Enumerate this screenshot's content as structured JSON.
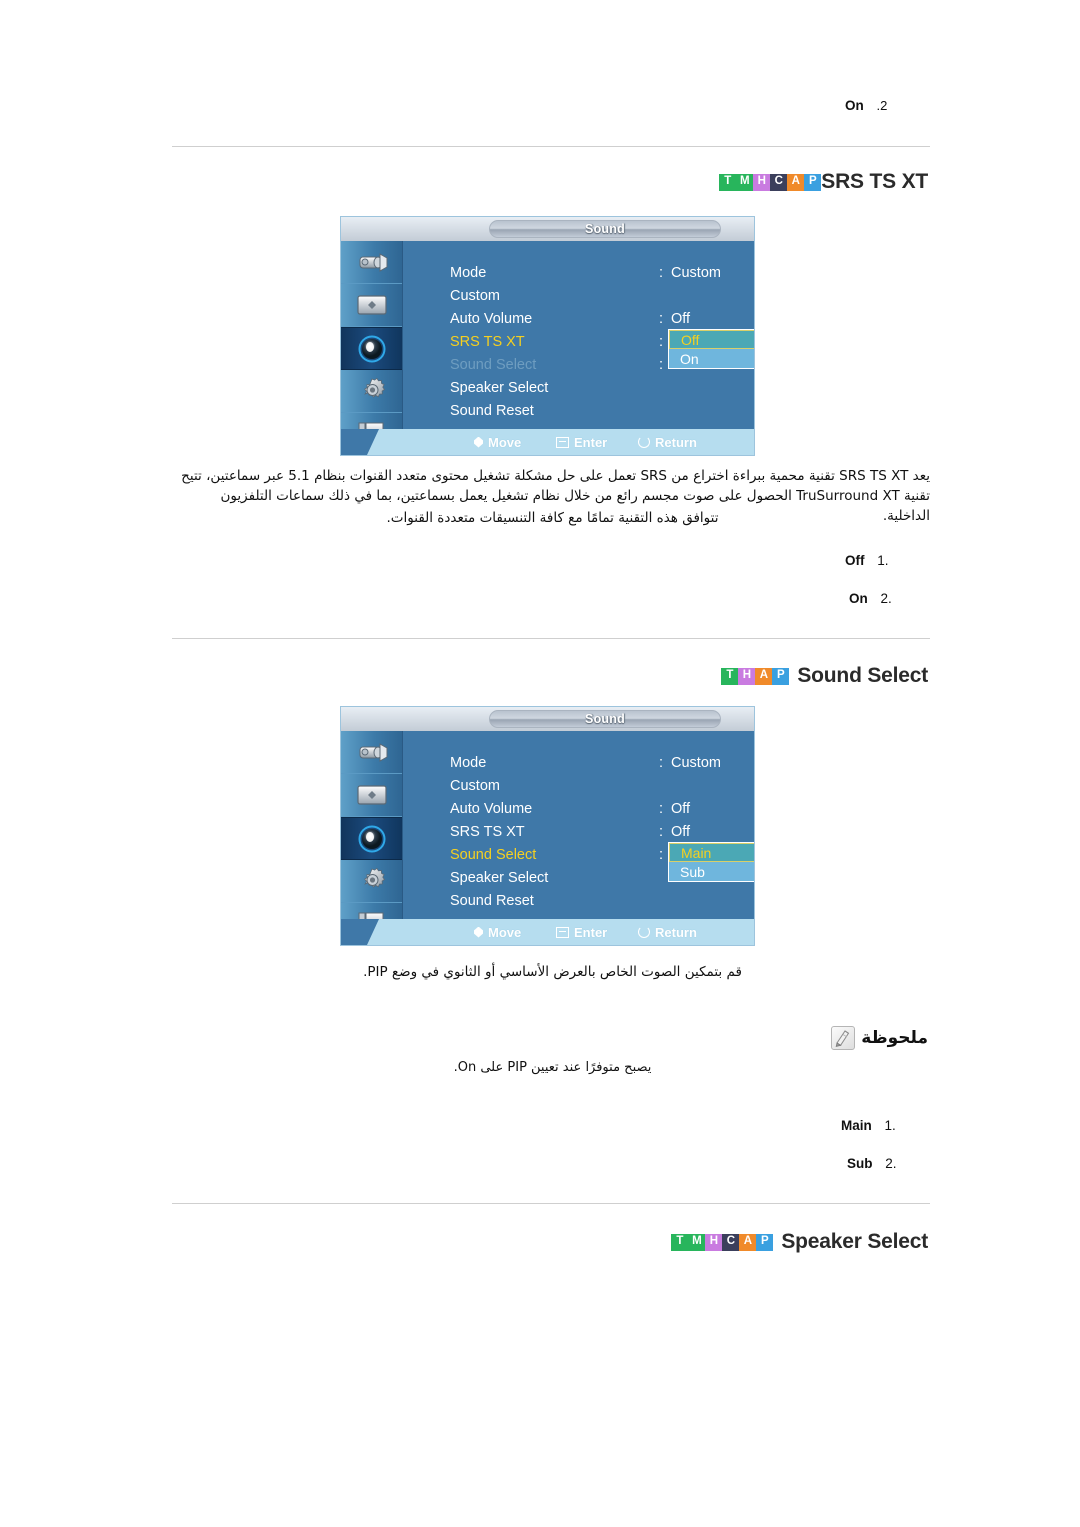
{
  "top_step": {
    "label": "On",
    "number": ".2"
  },
  "sections": [
    {
      "id": "srs-ts-xt",
      "badges": [
        {
          "letter": "T",
          "color": "#28b55c"
        },
        {
          "letter": "M",
          "color": "#28b55c"
        },
        {
          "letter": "H",
          "color": "#c97be0"
        },
        {
          "letter": "C",
          "color": "#3b3f5c"
        },
        {
          "letter": "A",
          "color": "#f08a2a"
        },
        {
          "letter": "P",
          "color": "#3aa0e0"
        }
      ],
      "title": "SRS TS XT",
      "osd": {
        "title": "Sound",
        "rows": [
          {
            "label": "Mode",
            "colon": ":",
            "value": "Custom",
            "state": "normal"
          },
          {
            "label": "Custom",
            "colon": "",
            "value": "",
            "state": "normal"
          },
          {
            "label": "Auto Volume",
            "colon": ":",
            "value": "Off",
            "state": "normal"
          },
          {
            "label": "SRS TS XT",
            "colon": ":",
            "value": "",
            "state": "active"
          },
          {
            "label": "Sound Select",
            "colon": ":",
            "value": "",
            "state": "dim"
          },
          {
            "label": "Speaker Select",
            "colon": "",
            "value": "",
            "state": "normal"
          },
          {
            "label": "Sound Reset",
            "colon": "",
            "value": "",
            "state": "normal"
          }
        ],
        "dropdown": {
          "selected": "Off",
          "other": "On"
        },
        "footer": [
          {
            "icon": "move-diamond-icon",
            "label": "Move"
          },
          {
            "icon": "enter-icon",
            "label": "Enter"
          },
          {
            "icon": "return-icon",
            "label": "Return"
          }
        ],
        "sidebar_icons": [
          "input-source-icon",
          "picture-icon",
          "sound-icon",
          "setup-icon",
          "multi-control-icon"
        ]
      },
      "paragraphs": [
        "يعد SRS TS XT تقنية محمية ببراءة اختراع من SRS تعمل على حل مشكلة تشغيل محتوى متعدد القنوات بنظام 5.1 عبر سماعتين، تتيح تقنية TruSurround XT الحصول على صوت مجسم رائع من خلال نظام تشغيل يعمل بسماعتين، بما في ذلك سماعات التلفزيون الداخلية.",
        "تتوافق هذه التقنية تمامًا مع كافة التنسيقات متعددة القنوات."
      ],
      "options": [
        {
          "label": "Off",
          "number": ".1"
        },
        {
          "label": "On",
          "number": ".2"
        }
      ]
    },
    {
      "id": "sound-select",
      "badges": [
        {
          "letter": "T",
          "color": "#28b55c"
        },
        {
          "letter": "H",
          "color": "#c97be0"
        },
        {
          "letter": "A",
          "color": "#f08a2a"
        },
        {
          "letter": "P",
          "color": "#3aa0e0"
        }
      ],
      "title": "Sound Select",
      "osd": {
        "title": "Sound",
        "rows": [
          {
            "label": "Mode",
            "colon": ":",
            "value": "Custom",
            "state": "normal"
          },
          {
            "label": "Custom",
            "colon": "",
            "value": "",
            "state": "normal"
          },
          {
            "label": "Auto Volume",
            "colon": ":",
            "value": "Off",
            "state": "normal"
          },
          {
            "label": "SRS TS XT",
            "colon": ":",
            "value": "Off",
            "state": "normal"
          },
          {
            "label": "Sound Select",
            "colon": ":",
            "value": "",
            "state": "active"
          },
          {
            "label": "Speaker Select",
            "colon": "",
            "value": "",
            "state": "normal"
          },
          {
            "label": "Sound Reset",
            "colon": "",
            "value": "",
            "state": "normal"
          }
        ],
        "dropdown": {
          "selected": "Main",
          "other": "Sub"
        },
        "footer": [
          {
            "icon": "move-diamond-icon",
            "label": "Move"
          },
          {
            "icon": "enter-icon",
            "label": "Enter"
          },
          {
            "icon": "return-icon",
            "label": "Return"
          }
        ],
        "sidebar_icons": [
          "input-source-icon",
          "picture-icon",
          "sound-icon",
          "setup-icon",
          "multi-control-icon"
        ]
      },
      "paragraphs": [
        "قم بتمكين الصوت الخاص بالعرض الأساسي أو الثانوي في وضع PIP."
      ],
      "note": {
        "icon": "note-pencil-icon",
        "heading": "ملحوظة",
        "text": "يصبح متوفرًا عند تعيين PIP على On."
      },
      "options": [
        {
          "label": "Main",
          "number": ".1"
        },
        {
          "label": "Sub",
          "number": ".2"
        }
      ]
    },
    {
      "id": "speaker-select",
      "badges": [
        {
          "letter": "T",
          "color": "#28b55c"
        },
        {
          "letter": "M",
          "color": "#28b55c"
        },
        {
          "letter": "H",
          "color": "#c97be0"
        },
        {
          "letter": "C",
          "color": "#3b3f5c"
        },
        {
          "letter": "A",
          "color": "#f08a2a"
        },
        {
          "letter": "P",
          "color": "#3aa0e0"
        }
      ],
      "title": "Speaker Select"
    }
  ],
  "colors": {
    "osd_body": "#3f78a8",
    "osd_footer": "#b6ddef",
    "highlight_selected": "#4ba8b5",
    "highlight_selected_text": "#f5d020",
    "highlight_other": "#6fb6dd",
    "active_label": "#f5d020",
    "dim_label": "#6e9dc0",
    "rule": "#cfcfcf"
  }
}
